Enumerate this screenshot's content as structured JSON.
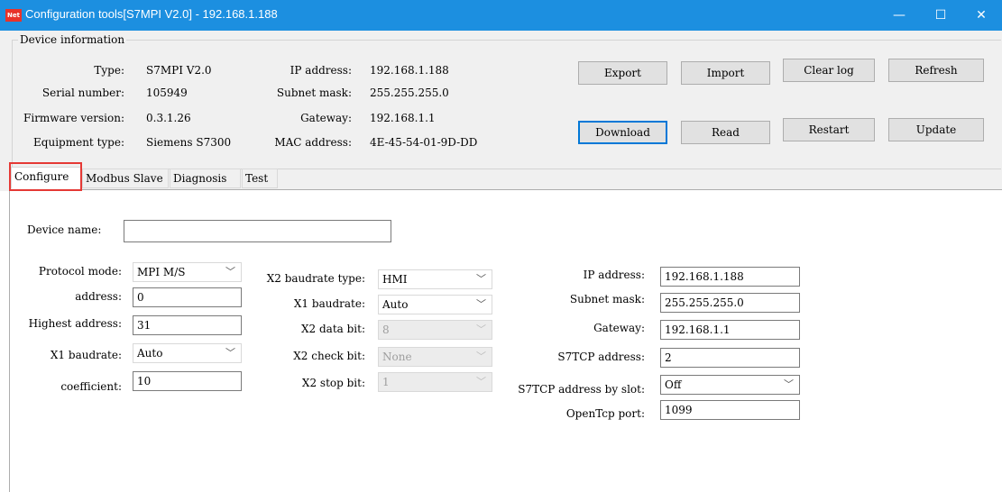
{
  "window": {
    "title": "Configuration tools[S7MPI V2.0] - 192.168.1.188",
    "app_icon": "Net",
    "minimize_glyph": "—",
    "maximize_glyph": "☐",
    "close_glyph": "✕",
    "titlebar_color": "#1c8fe0"
  },
  "device_info": {
    "legend": "Device information",
    "type_label": "Type:",
    "type_value": "S7MPI V2.0",
    "serial_label": "Serial number:",
    "serial_value": "105949",
    "firmware_label": "Firmware version:",
    "firmware_value": "0.3.1.26",
    "equipment_label": "Equipment type:",
    "equipment_value": "Siemens S7300",
    "ip_label": "IP  address:",
    "ip_value": "192.168.1.188",
    "subnet_label": "Subnet mask:",
    "subnet_value": "255.255.255.0",
    "gateway_label": "Gateway:",
    "gateway_value": "192.168.1.1",
    "mac_label": "MAC address:",
    "mac_value": "4E-45-54-01-9D-DD"
  },
  "buttons": {
    "export": "Export",
    "import": "Import",
    "clear_log": "Clear log",
    "refresh": "Refresh",
    "download": "Download",
    "read": "Read",
    "restart": "Restart",
    "update": "Update"
  },
  "tabs": [
    "Configure",
    "Modbus Slave",
    "Diagnosis",
    "Test"
  ],
  "highlight_color": "#e53935",
  "configure": {
    "device_name_label": "Device name:",
    "device_name_value": "",
    "protocol_mode_label": "Protocol mode:",
    "protocol_mode_value": "MPI M/S",
    "address_label": "address:",
    "address_value": "0",
    "highest_address_label": "Highest address:",
    "highest_address_value": "31",
    "x1_baudrate_left_label": "X1 baudrate:",
    "x1_baudrate_left_value": "Auto",
    "coefficient_label": "coefficient:",
    "coefficient_value": "10",
    "x2_baudrate_type_label": "X2 baudrate type:",
    "x2_baudrate_type_value": "HMI",
    "x1_baudrate_label": "X1 baudrate:",
    "x1_baudrate_value": "Auto",
    "x2_data_bit_label": "X2 data bit:",
    "x2_data_bit_value": "8",
    "x2_check_bit_label": "X2 check bit:",
    "x2_check_bit_value": "None",
    "x2_stop_bit_label": "X2 stop bit:",
    "x2_stop_bit_value": "1",
    "ip_label": "IP  address:",
    "ip_value": "192.168.1.188",
    "subnet_label": "Subnet mask:",
    "subnet_value": "255.255.255.0",
    "gateway_label": "Gateway:",
    "gateway_value": "192.168.1.1",
    "s7tcp_address_label": "S7TCP address:",
    "s7tcp_address_value": "2",
    "s7tcp_by_slot_label": "S7TCP address by slot:",
    "s7tcp_by_slot_value": "Off",
    "opentcp_port_label": "OpenTcp port:",
    "opentcp_port_value": "1099"
  }
}
